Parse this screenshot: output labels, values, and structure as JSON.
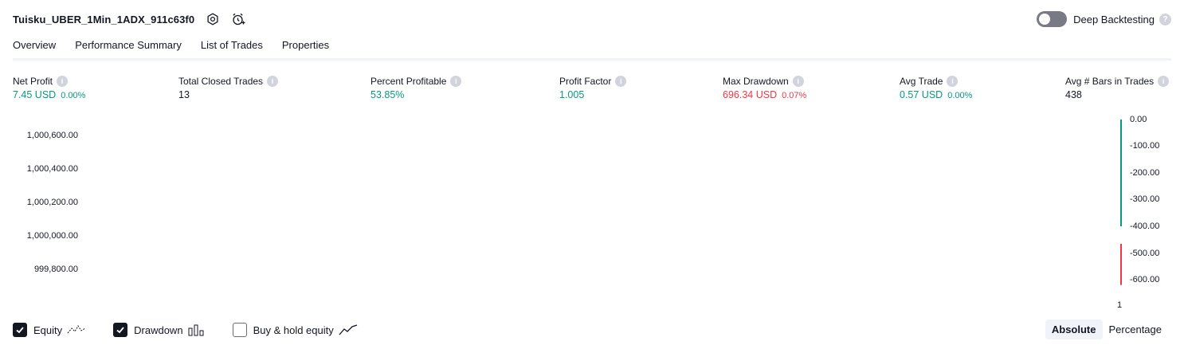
{
  "header": {
    "strategy_name": "Tuisku_UBER_1Min_1ADX_911c63f0",
    "settings_icon": "gear-icon",
    "alert_icon": "alarm-clock-plus-icon"
  },
  "deep_backtesting": {
    "label": "Deep Backtesting",
    "enabled": false,
    "help_glyph": "?"
  },
  "tabs": [
    {
      "label": "Overview",
      "active": true
    },
    {
      "label": "Performance Summary",
      "active": false
    },
    {
      "label": "List of Trades",
      "active": false
    },
    {
      "label": "Properties",
      "active": false
    }
  ],
  "metrics": {
    "net_profit": {
      "label": "Net Profit",
      "value": "7.45 USD",
      "pct": "0.00%"
    },
    "total_closed_trades": {
      "label": "Total Closed Trades",
      "value": "13"
    },
    "percent_profitable": {
      "label": "Percent Profitable",
      "value": "53.85%"
    },
    "profit_factor": {
      "label": "Profit Factor",
      "value": "1.005"
    },
    "max_drawdown": {
      "label": "Max Drawdown",
      "value": "696.34 USD",
      "pct": "0.07%"
    },
    "avg_trade": {
      "label": "Avg Trade",
      "value": "0.57 USD",
      "pct": "0.00%"
    },
    "avg_bars": {
      "label": "Avg # Bars in Trades",
      "value": "438"
    }
  },
  "chart": {
    "left_axis_ticks": [
      "1,000,600.00",
      "1,000,400.00",
      "1,000,200.00",
      "1,000,000.00",
      "999,800.00"
    ],
    "right_axis_ticks": [
      "0.00",
      "-100.00",
      "-200.00",
      "-300.00",
      "-400.00",
      "-500.00",
      "-600.00"
    ],
    "x_axis_ticks": [
      "1"
    ]
  },
  "chart_data": {
    "type": "bar",
    "categories": [
      "1"
    ],
    "series": [
      {
        "name": "Drawdown",
        "values": [
          -400,
          -620
        ]
      }
    ],
    "left_axis": {
      "ticks": [
        1000600,
        1000400,
        1000200,
        1000000,
        999800
      ]
    },
    "right_axis": {
      "ylim": [
        -620,
        0
      ],
      "ticks": [
        0,
        -100,
        -200,
        -300,
        -400,
        -500,
        -600
      ]
    },
    "colors": {
      "positive": "#089981",
      "negative": "#f23645"
    }
  },
  "legend": {
    "equity": {
      "label": "Equity",
      "checked": true
    },
    "drawdown": {
      "label": "Drawdown",
      "checked": true
    },
    "buy_hold": {
      "label": "Buy & hold equity",
      "checked": false
    }
  },
  "mode_toggle": {
    "absolute": "Absolute",
    "percentage": "Percentage",
    "selected": "Absolute"
  },
  "colors": {
    "green": "#089981",
    "red": "#f23645",
    "text": "#131722",
    "muted": "#d1d4dc"
  }
}
